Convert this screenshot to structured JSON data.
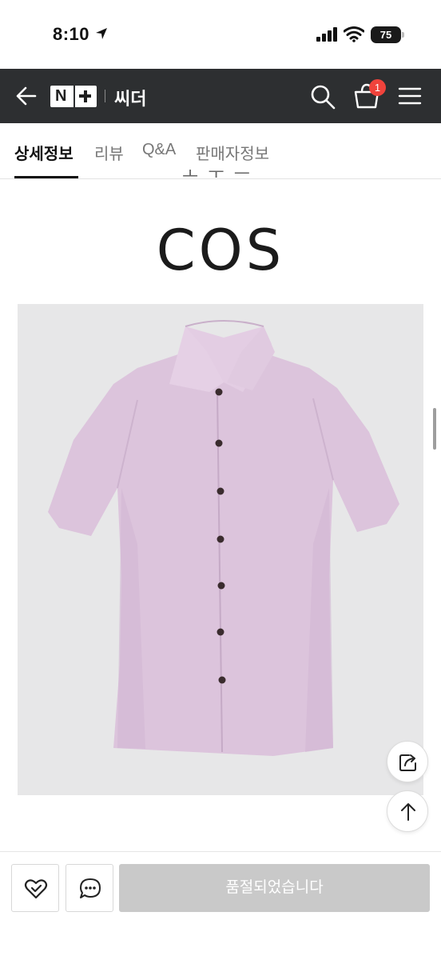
{
  "status_bar": {
    "time": "8:10",
    "battery": "75"
  },
  "header": {
    "store_name": "씨더",
    "cart_count": "1"
  },
  "tabs": [
    {
      "label": "상세정보",
      "active": true
    },
    {
      "label": "리뷰",
      "active": false
    },
    {
      "label": "Q&A",
      "active": false
    },
    {
      "label": "판매자정보",
      "active": false
    }
  ],
  "content": {
    "brand_logo": "COS",
    "image_background": "#e7e7e8",
    "shirt_color": "#dcc4dc"
  },
  "bottom_bar": {
    "soldout_label": "품절되었습니다"
  },
  "colors": {
    "header_bg": "#2d2f31",
    "badge": "#f0433c",
    "soldout_bg": "#c9c9c9"
  }
}
